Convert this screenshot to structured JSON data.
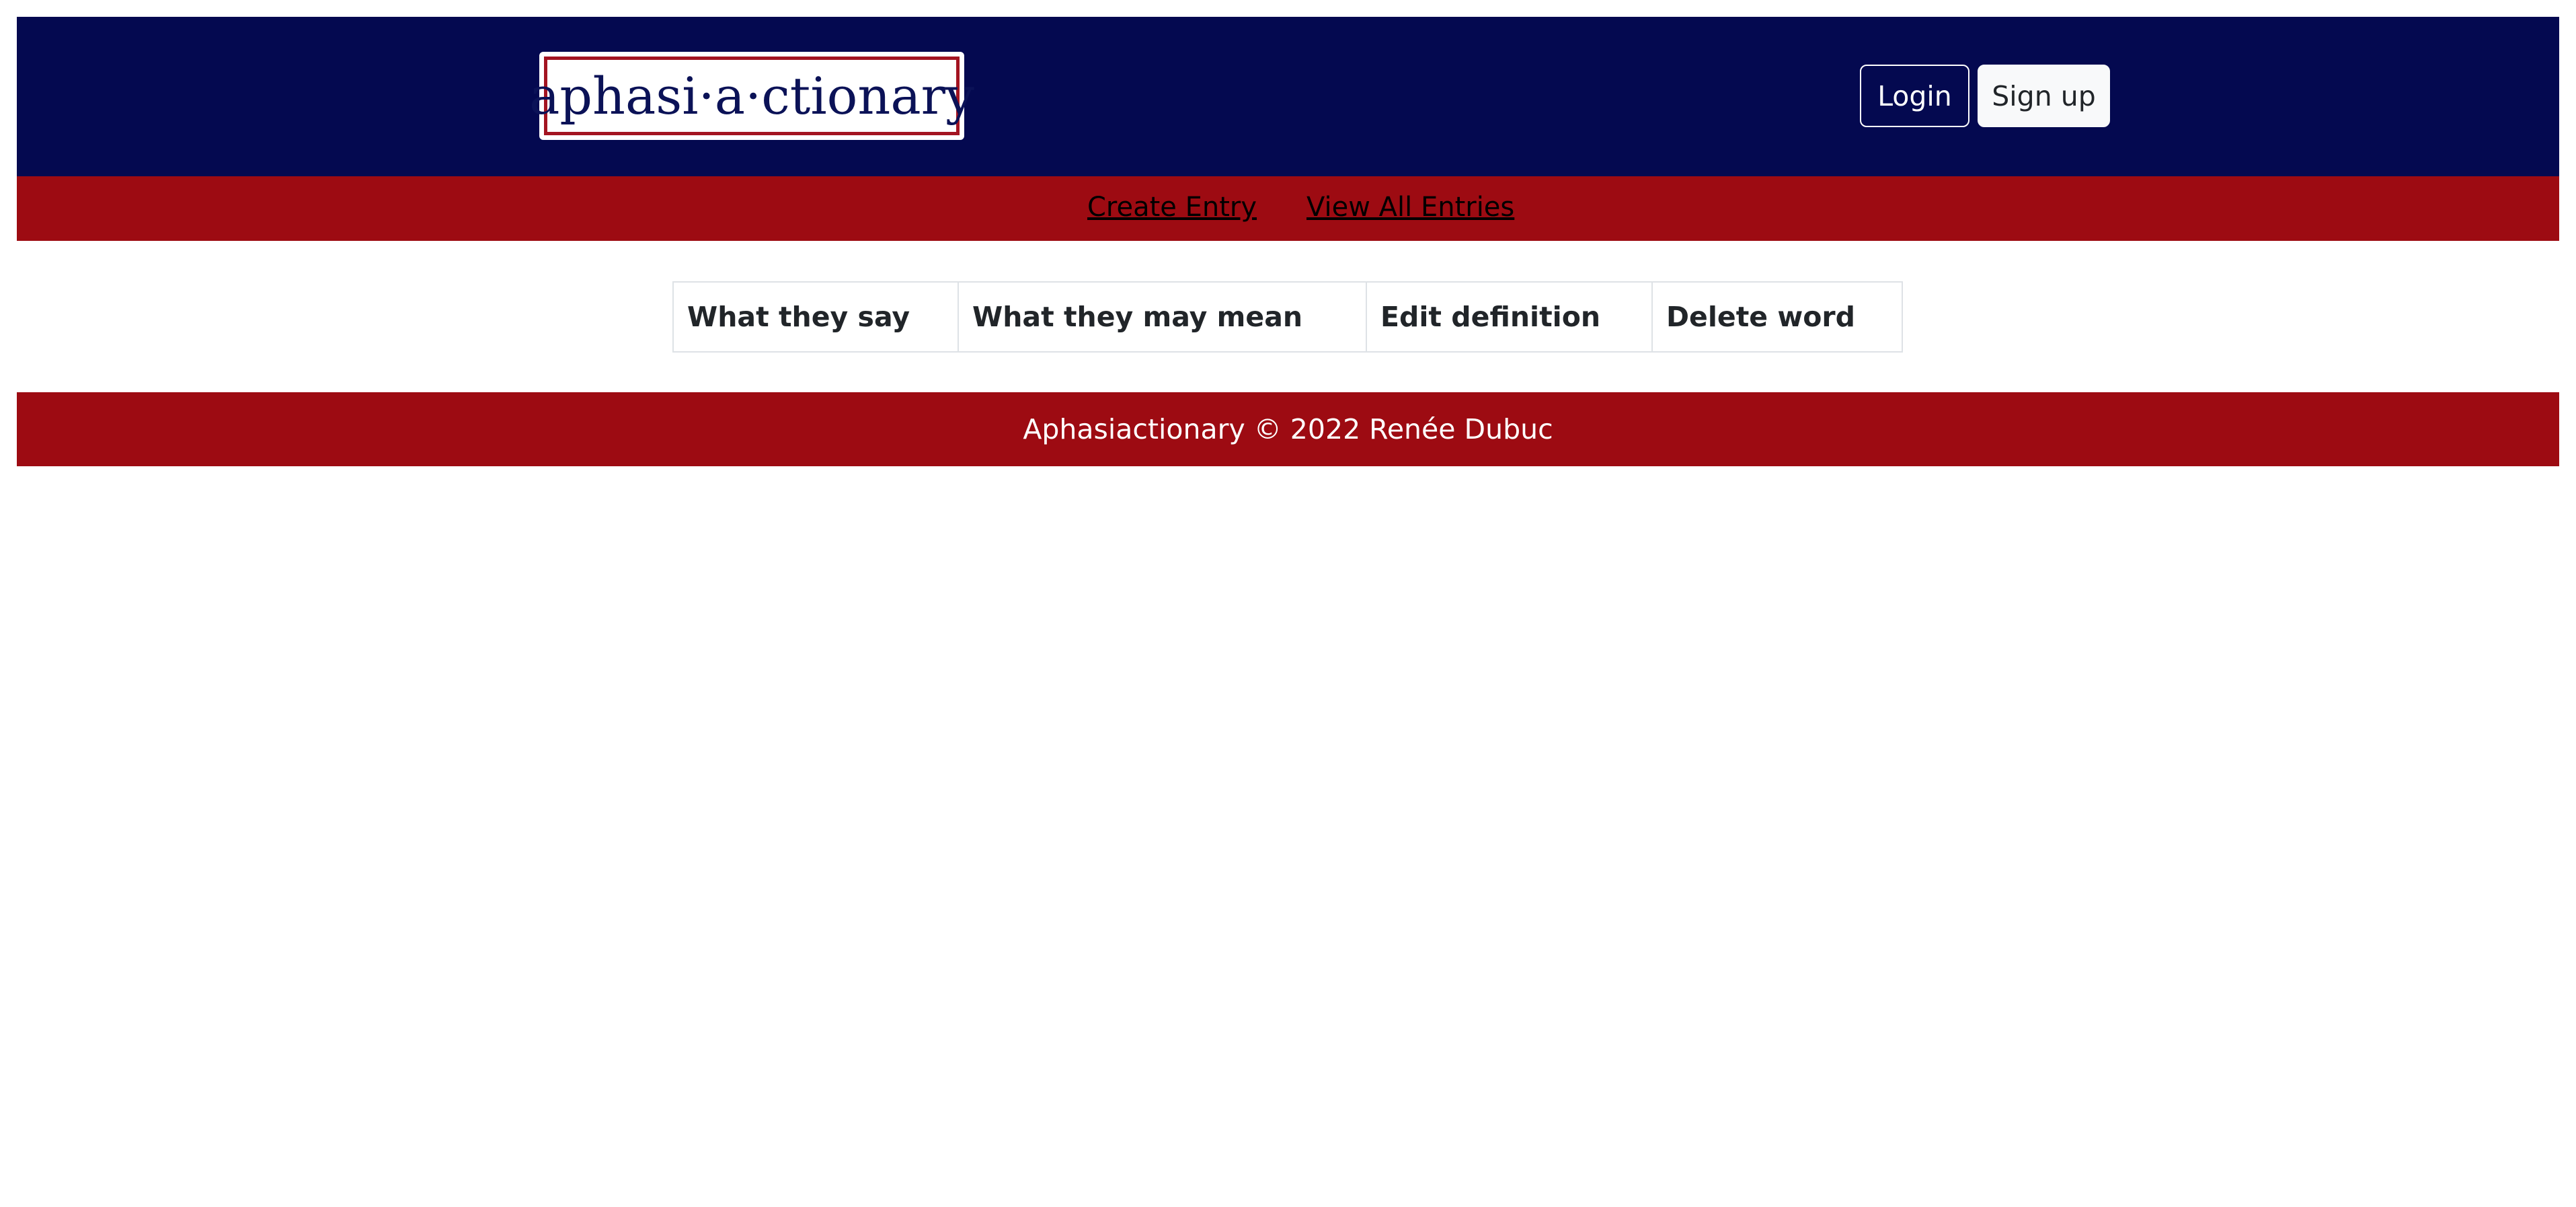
{
  "header": {
    "logo_text": "aphasi·a·ctionary",
    "login_label": "Login",
    "signup_label": "Sign up"
  },
  "nav": {
    "create_entry": "Create Entry",
    "view_all_entries": "View All Entries"
  },
  "table": {
    "columns": [
      "What they say",
      "What they may mean",
      "Edit definition",
      "Delete word"
    ],
    "rows": []
  },
  "footer": {
    "text": "Aphasiactionary © 2022 Renée Dubuc"
  },
  "colors": {
    "header_bg": "#040950",
    "nav_bg": "#9d0b12",
    "footer_bg": "#9d0b12",
    "logo_border": "#a31421"
  }
}
